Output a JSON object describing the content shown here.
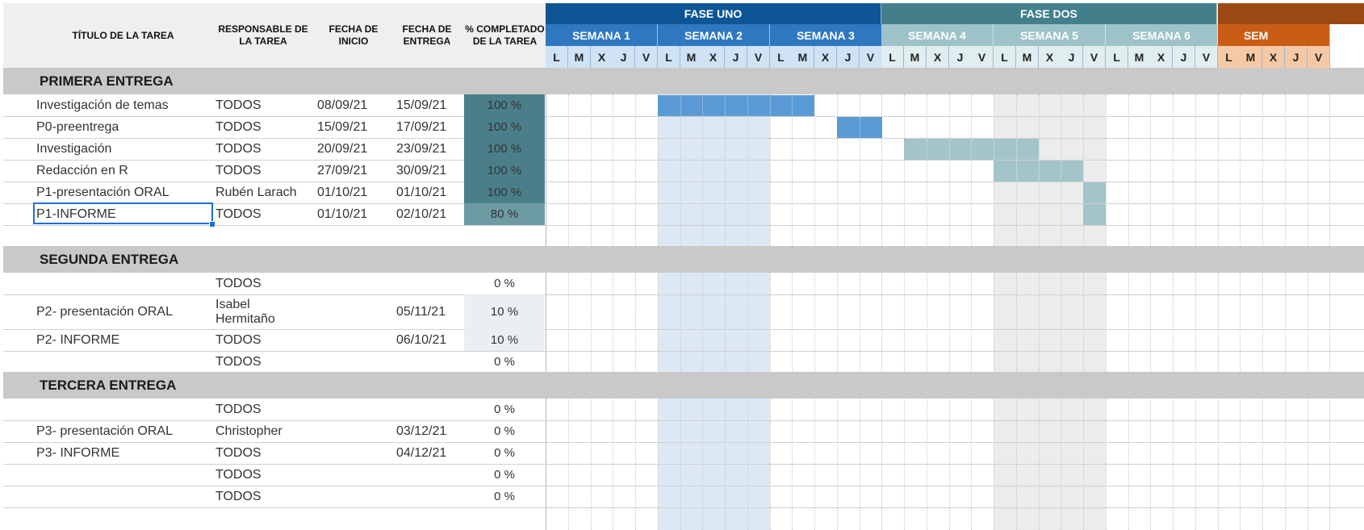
{
  "headers": {
    "titulo": "TÍTULO DE LA TAREA",
    "responsable": "RESPONSABLE DE LA TAREA",
    "inicio": "FECHA DE INICIO",
    "entrega": "FECHA DE ENTREGA",
    "completado": "% COMPLETADO DE LA TAREA"
  },
  "phases": [
    {
      "label": "FASE UNO",
      "color": "#0e5596"
    },
    {
      "label": "FASE DOS",
      "color": "#437f8b"
    },
    {
      "label": "",
      "color": "#9a4a12"
    }
  ],
  "weeks": [
    {
      "label": "SEMANA 1",
      "color": "#2f78bf",
      "dayColor": "#cfe3f5"
    },
    {
      "label": "SEMANA 2",
      "color": "#2f78bf",
      "dayColor": "#cfe3f5"
    },
    {
      "label": "SEMANA 3",
      "color": "#2f78bf",
      "dayColor": "#cfe3f5"
    },
    {
      "label": "SEMANA 4",
      "color": "#9dc3c8",
      "dayColor": "#e1eef0"
    },
    {
      "label": "SEMANA 5",
      "color": "#9dc3c8",
      "dayColor": "#e1eef0"
    },
    {
      "label": "SEMANA 6",
      "color": "#9dc3c8",
      "dayColor": "#e1eef0"
    },
    {
      "label": "SEM",
      "color": "#c95d16",
      "dayColor": "#f6c9a6"
    }
  ],
  "days": [
    "L",
    "M",
    "X",
    "J",
    "V"
  ],
  "sections": [
    {
      "title": "PRIMERA ENTREGA"
    },
    {
      "title": "SEGUNDA ENTREGA"
    },
    {
      "title": "TERCERA ENTREGA"
    }
  ],
  "rows": [
    {
      "titulo": "Investigación de temas",
      "responsable": "TODOS",
      "inicio": "08/09/21",
      "entrega": "15/09/21",
      "pct": "100 %",
      "pctValue": 100
    },
    {
      "titulo": "P0-preentrega",
      "responsable": "TODOS",
      "inicio": "15/09/21",
      "entrega": "17/09/21",
      "pct": "100 %",
      "pctValue": 100
    },
    {
      "titulo": "Investigación",
      "responsable": "TODOS",
      "inicio": "20/09/21",
      "entrega": "23/09/21",
      "pct": "100 %",
      "pctValue": 100
    },
    {
      "titulo": "Redacción en R",
      "responsable": "TODOS",
      "inicio": "27/09/21",
      "entrega": "30/09/21",
      "pct": "100 %",
      "pctValue": 100
    },
    {
      "titulo": "P1-presentación ORAL",
      "responsable": "Rubén Larach",
      "inicio": "01/10/21",
      "entrega": "01/10/21",
      "pct": "100 %",
      "pctValue": 100
    },
    {
      "titulo": "P1-INFORME",
      "responsable": "TODOS",
      "inicio": "01/10/21",
      "entrega": "02/10/21",
      "pct": "80 %",
      "pctValue": 80
    },
    {
      "titulo": "",
      "responsable": "TODOS",
      "inicio": "",
      "entrega": "",
      "pct": "0 %",
      "pctValue": 0
    },
    {
      "titulo": "P2- presentación ORAL",
      "responsable": "Isabel Hermitaño",
      "inicio": "",
      "entrega": "05/11/21",
      "pct": "10 %",
      "pctValue": 10
    },
    {
      "titulo": "P2- INFORME",
      "responsable": "TODOS",
      "inicio": "",
      "entrega": "06/10/21",
      "pct": "10 %",
      "pctValue": 10
    },
    {
      "titulo": "",
      "responsable": "TODOS",
      "inicio": "",
      "entrega": "",
      "pct": "0 %",
      "pctValue": 0
    },
    {
      "titulo": "",
      "responsable": "TODOS",
      "inicio": "",
      "entrega": "",
      "pct": "0 %",
      "pctValue": 0
    },
    {
      "titulo": "P3- presentación ORAL",
      "responsable": "Christopher",
      "inicio": "",
      "entrega": "03/12/21",
      "pct": "0 %",
      "pctValue": 0
    },
    {
      "titulo": "P3- INFORME",
      "responsable": "TODOS",
      "inicio": "",
      "entrega": "04/12/21",
      "pct": "0 %",
      "pctValue": 0
    },
    {
      "titulo": "",
      "responsable": "TODOS",
      "inicio": "",
      "entrega": "",
      "pct": "0 %",
      "pctValue": 0
    },
    {
      "titulo": "",
      "responsable": "TODOS",
      "inicio": "",
      "entrega": "",
      "pct": "0 %",
      "pctValue": 0
    }
  ],
  "gantt": [
    {
      "row": 0,
      "startDay": 5,
      "days": 7,
      "color": "#5b9bd5"
    },
    {
      "row": 1,
      "startDay": 13,
      "days": 2,
      "color": "#5b9bd5"
    },
    {
      "row": 2,
      "startDay": 16,
      "days": 6,
      "color": "#a3c4c9"
    },
    {
      "row": 3,
      "startDay": 20,
      "days": 4,
      "color": "#a3c4c9"
    },
    {
      "row": 4,
      "startDay": 24,
      "days": 1,
      "color": "#a3c4c9"
    },
    {
      "row": 5,
      "startDay": 24,
      "days": 1,
      "color": "#a3c4c9"
    }
  ],
  "colors": {
    "pctFull": "#4a7f8a",
    "pctPartial": "#6c9ba3",
    "pctLow": "#eaf0f2",
    "week2Shade": "#dce9f5",
    "week5Shade": "#ececec"
  }
}
